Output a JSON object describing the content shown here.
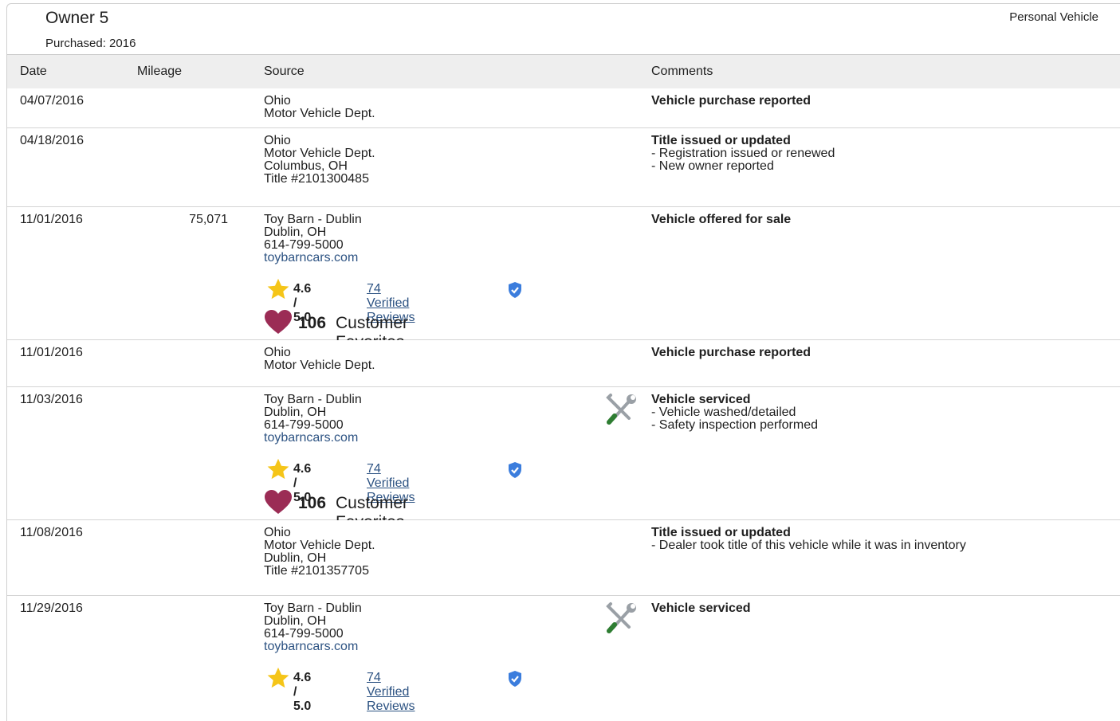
{
  "owner": {
    "title": "Owner 5",
    "purchased": "Purchased: 2016",
    "vehicle_type": "Personal Vehicle"
  },
  "table": {
    "headers": {
      "date": "Date",
      "mileage": "Mileage",
      "source": "Source",
      "comments": "Comments"
    },
    "rows": [
      {
        "date": "04/07/2016",
        "mileage": "",
        "source": [
          "Ohio",
          "Motor Vehicle Dept."
        ],
        "comment_title": "Vehicle purchase reported",
        "comment_items": []
      },
      {
        "date": "04/18/2016",
        "mileage": "",
        "source": [
          "Ohio",
          "Motor Vehicle Dept.",
          "Columbus, OH",
          "Title #2101300485"
        ],
        "comment_title": "Title issued or updated",
        "comment_items": [
          "- Registration issued or renewed",
          "- New owner reported"
        ]
      },
      {
        "date": "11/01/2016",
        "mileage": "75,071",
        "source": [
          "Toy Barn - Dublin",
          "Dublin, OH",
          "614-799-5000"
        ],
        "website": "toybarncars.com",
        "rating": "4.6 / 5.0",
        "reviews": "74 Verified Reviews",
        "fav_count": "106",
        "fav_label": "Customer Favorites",
        "comment_title": "Vehicle offered for sale",
        "comment_items": []
      },
      {
        "date": "11/01/2016",
        "mileage": "",
        "source": [
          "Ohio",
          "Motor Vehicle Dept."
        ],
        "comment_title": "Vehicle purchase reported",
        "comment_items": []
      },
      {
        "date": "11/03/2016",
        "mileage": "",
        "source": [
          "Toy Barn - Dublin",
          "Dublin, OH",
          "614-799-5000"
        ],
        "website": "toybarncars.com",
        "rating": "4.6 / 5.0",
        "reviews": "74 Verified Reviews",
        "fav_count": "106",
        "fav_label": "Customer Favorites",
        "icon": "service-tools-icon",
        "comment_title": "Vehicle serviced",
        "comment_items": [
          "- Vehicle washed/detailed",
          "- Safety inspection performed"
        ]
      },
      {
        "date": "11/08/2016",
        "mileage": "",
        "source": [
          "Ohio",
          "Motor Vehicle Dept.",
          "Dublin, OH",
          "Title #2101357705"
        ],
        "comment_title": "Title issued or updated",
        "comment_items": [
          "- Dealer took title of this vehicle while it was in inventory"
        ]
      },
      {
        "date": "11/29/2016",
        "mileage": "",
        "source": [
          "Toy Barn - Dublin",
          "Dublin, OH",
          "614-799-5000"
        ],
        "website": "toybarncars.com",
        "rating": "4.6 / 5.0",
        "reviews": "74 Verified Reviews",
        "icon": "service-tools-icon",
        "comment_title": "Vehicle serviced",
        "comment_items": []
      }
    ]
  },
  "colors": {
    "link": "#2c5282",
    "star": "#f5c518",
    "heart": "#9b2c55",
    "verified": "#3b7ddd",
    "header_bg": "#eeeeee"
  }
}
